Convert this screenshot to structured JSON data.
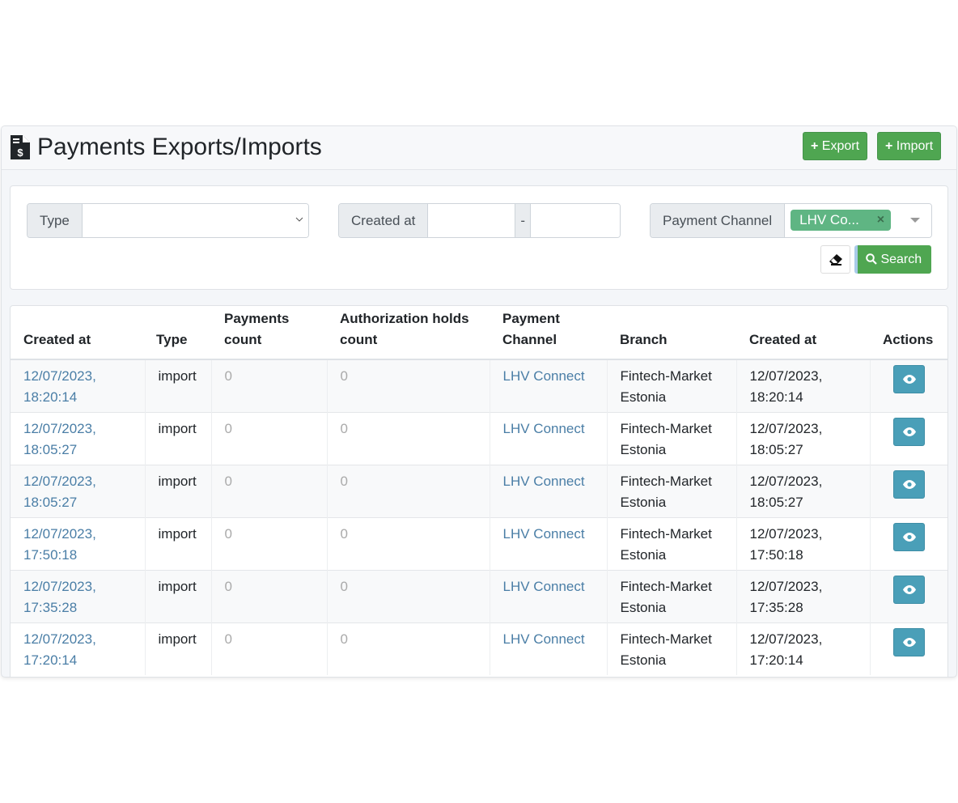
{
  "header": {
    "title": "Payments Exports/Imports",
    "export_label": "Export",
    "import_label": "Import"
  },
  "filters": {
    "type_label": "Type",
    "type_value": "",
    "created_label": "Created at",
    "date_sep": "-",
    "date_from": "",
    "date_to": "",
    "channel_label": "Payment Channel",
    "channel_tag": "LHV Co...",
    "search_label": "Search"
  },
  "table": {
    "columns": [
      "Created at",
      "Type",
      "Payments count",
      "Authorization holds count",
      "Payment Channel",
      "Branch",
      "Created at",
      "Actions"
    ],
    "rows": [
      {
        "created": "12/07/2023, 18:20:14",
        "type": "import",
        "payments": "0",
        "holds": "0",
        "channel": "LHV Connect",
        "branch": "Fintech-Market Estonia",
        "created2": "12/07/2023, 18:20:14"
      },
      {
        "created": "12/07/2023, 18:05:27",
        "type": "import",
        "payments": "0",
        "holds": "0",
        "channel": "LHV Connect",
        "branch": "Fintech-Market Estonia",
        "created2": "12/07/2023, 18:05:27"
      },
      {
        "created": "12/07/2023, 18:05:27",
        "type": "import",
        "payments": "0",
        "holds": "0",
        "channel": "LHV Connect",
        "branch": "Fintech-Market Estonia",
        "created2": "12/07/2023, 18:05:27"
      },
      {
        "created": "12/07/2023, 17:50:18",
        "type": "import",
        "payments": "0",
        "holds": "0",
        "channel": "LHV Connect",
        "branch": "Fintech-Market Estonia",
        "created2": "12/07/2023, 17:50:18"
      },
      {
        "created": "12/07/2023, 17:35:28",
        "type": "import",
        "payments": "0",
        "holds": "0",
        "channel": "LHV Connect",
        "branch": "Fintech-Market Estonia",
        "created2": "12/07/2023, 17:35:28"
      },
      {
        "created": "12/07/2023, 17:20:14",
        "type": "import",
        "payments": "0",
        "holds": "0",
        "channel": "LHV Connect",
        "branch": "Fintech-Market Estonia",
        "created2": "12/07/2023, 17:20:14"
      }
    ]
  },
  "colors": {
    "green": "#4fa651",
    "tag": "#5fb583",
    "link": "#4a7ea6",
    "info": "#4a9fb8"
  }
}
